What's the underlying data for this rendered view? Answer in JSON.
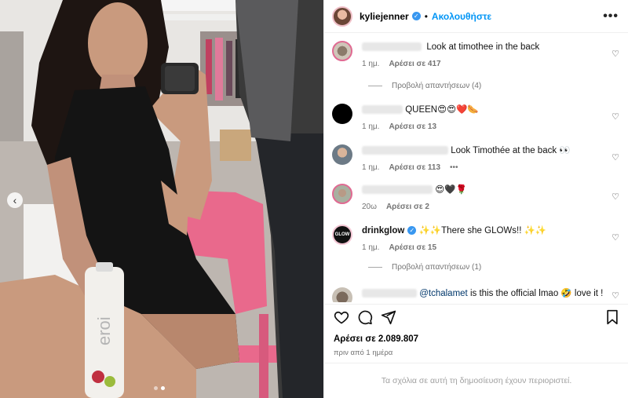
{
  "header": {
    "username": "kyliejenner",
    "follow_label": "Ακολουθήστε",
    "separator": "•",
    "more_label": "•••"
  },
  "comments": [
    {
      "user": "",
      "text": "Look at timothee in the back",
      "time": "1 ημ.",
      "likes": "Αρέσει σε 417",
      "avatar": "photo-pink-ring"
    },
    {
      "user": "",
      "text": "QUEEN😍😍❤️🌭",
      "time": "1 ημ.",
      "likes": "Αρέσει σε 13",
      "avatar": "black"
    },
    {
      "user": "",
      "text": "Look Timothée at the back 👀",
      "time": "1 ημ.",
      "likes": "Αρέσει σε 113",
      "more": "•••",
      "avatar": "photo"
    },
    {
      "user": "",
      "text": "😍🖤🌹",
      "time": "20ω",
      "likes": "Αρέσει σε 2",
      "avatar": "photo-pink-ring"
    },
    {
      "user": "drinkglow",
      "text": "✨✨There she GLOWs!! ✨✨",
      "time": "1 ημ.",
      "likes": "Αρέσει σε 15",
      "avatar": "glow-logo",
      "verified": true
    },
    {
      "user": "",
      "mention": "@tchalamet",
      "text": " is this the official lmao 🤣 love it !",
      "avatar": "photo"
    }
  ],
  "replies": [
    {
      "label": "Προβολή απαντήσεων (4)"
    },
    {
      "label": "Προβολή απαντήσεων (1)"
    }
  ],
  "avatar_logo_text": "GLOW",
  "actions": {
    "icons": [
      "heart-icon",
      "comment-icon",
      "share-icon",
      "bookmark-icon"
    ]
  },
  "post": {
    "likes_total": "Αρέσει σε 2.089.807",
    "time_ago": "πριν από 1 ημέρα",
    "restricted_notice": "Τα σχόλια σε αυτή τη δημοσίευση έχουν περιοριστεί."
  },
  "photo": {
    "bottle_text": "eroi",
    "nav_prev": "‹"
  },
  "colors": {
    "accent": "#0095f6",
    "verified": "#3897f0",
    "chair": "#e9698c",
    "dress": "#141414"
  }
}
